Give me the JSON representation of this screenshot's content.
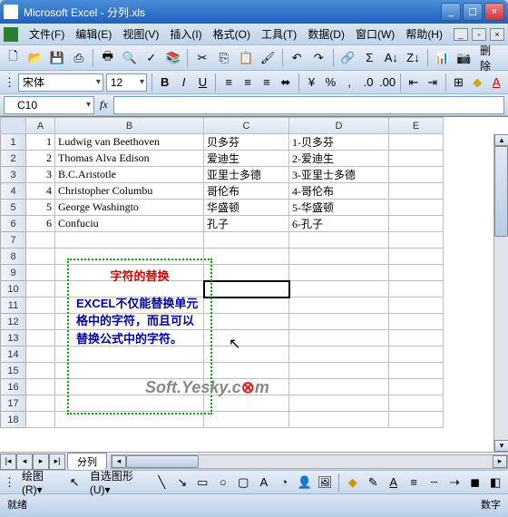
{
  "title": "Microsoft Excel - 分列.xls",
  "menus": [
    "文件(F)",
    "编辑(E)",
    "视图(V)",
    "插入(I)",
    "格式(O)",
    "工具(T)",
    "数据(D)",
    "窗口(W)",
    "帮助(H)"
  ],
  "toolbar_end": "删除",
  "font": {
    "name": "宋体",
    "size": "12"
  },
  "name_box": "C10",
  "fx_label": "fx",
  "cols": [
    "A",
    "B",
    "C",
    "D",
    "E"
  ],
  "rows": [
    "1",
    "2",
    "3",
    "4",
    "5",
    "6",
    "7",
    "8",
    "9",
    "10",
    "11",
    "12",
    "13",
    "14",
    "15",
    "16",
    "17",
    "18"
  ],
  "cells": [
    {
      "a": "1",
      "b": "Ludwig van Beethoven",
      "c": "贝多芬",
      "d": "1-贝多芬"
    },
    {
      "a": "2",
      "b": "Thomas Alva Edison",
      "c": "爱迪生",
      "d": "2-爱迪生"
    },
    {
      "a": "3",
      "b": "B.C.Aristotle",
      "c": "亚里士多德",
      "d": "3-亚里士多德"
    },
    {
      "a": "4",
      "b": "Christopher Columbu",
      "c": "哥伦布",
      "d": "4-哥伦布"
    },
    {
      "a": "5",
      "b": "George Washingto",
      "c": "华盛顿",
      "d": "5-华盛顿"
    },
    {
      "a": "6",
      "b": "Confuciu",
      "c": "孔子",
      "d": "6-孔子"
    }
  ],
  "note": {
    "title": "字符的替换",
    "body": "EXCEL不仅能替换单元格中的字符，而且可以替换公式中的字符。"
  },
  "watermark": {
    "a": "Soft.Yesky.c",
    "b": "⊗",
    "c": "m"
  },
  "sheet": "分列",
  "draw": {
    "label1": "绘图(R)▾",
    "label2": "自选图形(U)▾"
  },
  "status": {
    "left": "就绪",
    "right": "数字"
  }
}
